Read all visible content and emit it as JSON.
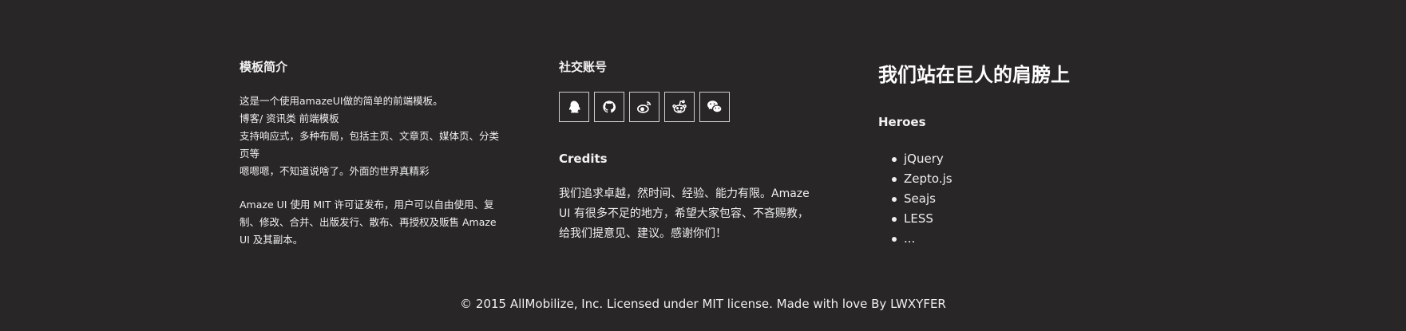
{
  "about": {
    "title": "模板简介",
    "lines": [
      "这是一个使用amazeUI做的简单的前端模板。",
      "博客/ 资讯类 前端模板",
      "支持响应式，多种布局，包括主页、文章页、媒体页、分类",
      "页等",
      "嗯嗯嗯，不知道说啥了。外面的世界真精彩"
    ],
    "license_lines": [
      "Amaze UI 使用 MIT 许可证发布，用户可以自由使用、复",
      "制、修改、合并、出版发行、散布、再授权及贩售 Amaze",
      "UI 及其副本。"
    ]
  },
  "social": {
    "title": "社交账号",
    "icons": [
      "qq-icon",
      "github-icon",
      "weibo-icon",
      "reddit-icon",
      "wechat-icon"
    ]
  },
  "credits": {
    "title": "Credits",
    "lines": [
      "我们追求卓越，然时间、经验、能力有限。Amaze",
      "UI 有很多不足的地方，希望大家包容、不吝赐教，",
      "给我们提意见、建议。感谢你们！"
    ]
  },
  "giants": {
    "title": "我们站在巨人的肩膀上",
    "heroes_title": "Heroes",
    "heroes": [
      "jQuery",
      "Zepto.js",
      "Seajs",
      "LESS",
      "..."
    ]
  },
  "copyright": "© 2015 AllMobilize, Inc. Licensed under MIT license. Made with love By LWXYFER"
}
